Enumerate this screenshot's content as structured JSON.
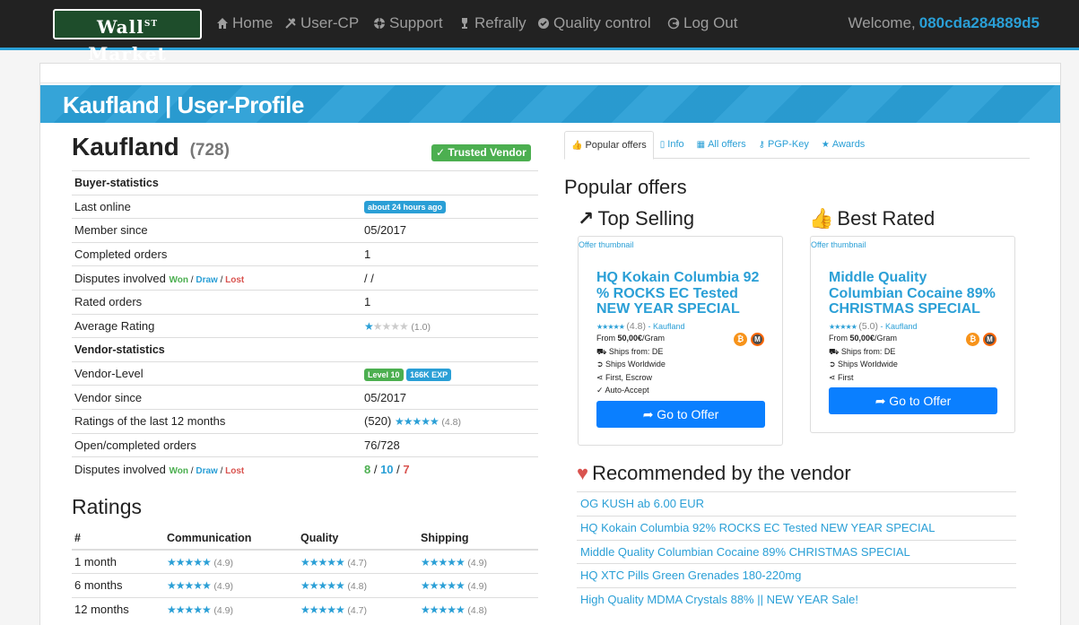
{
  "nav": {
    "logo_main": "Wall",
    "logo_sup": "ST",
    "logo_end": " Market",
    "items": [
      {
        "label": "Home",
        "icon": "home-icon"
      },
      {
        "label": "User-CP",
        "icon": "tools-icon"
      },
      {
        "label": "Support",
        "icon": "lifebuoy-icon"
      },
      {
        "label": "Refrally",
        "icon": "trophy-icon"
      },
      {
        "label": "Quality control",
        "icon": "check-circle-icon"
      },
      {
        "label": "Log Out",
        "icon": "logout-icon"
      }
    ],
    "welcome_label": "Welcome,",
    "username": "080cda284889d5"
  },
  "banner": {
    "title": "Kaufland | User-Profile"
  },
  "vendor": {
    "name": "Kaufland",
    "count": "(728)",
    "trusted_badge": "Trusted Vendor"
  },
  "stats": {
    "buyer_section": "Buyer-statistics",
    "last_online_label": "Last online",
    "last_online_value": "about 24 hours ago",
    "member_since_label": "Member since",
    "member_since_value": "05/2017",
    "completed_orders_label": "Completed orders",
    "completed_orders_value": "1",
    "disputes_label": "Disputes involved",
    "won": "Won",
    "draw": "Draw",
    "lost": "Lost",
    "buyer_disputes_value": "/ /",
    "rated_orders_label": "Rated orders",
    "rated_orders_value": "1",
    "avg_rating_label": "Average Rating",
    "avg_rating_value": "(1.0)",
    "avg_rating_stars": 1,
    "vendor_section": "Vendor-statistics",
    "vendor_level_label": "Vendor-Level",
    "vendor_level_badge": "Level 10",
    "vendor_exp_badge": "166K EXP",
    "vendor_since_label": "Vendor since",
    "vendor_since_value": "05/2017",
    "ratings12_label": "Ratings of the last 12 months",
    "ratings12_count": "(520)",
    "ratings12_score": "(4.8)",
    "open_completed_label": "Open/completed orders",
    "open_completed_value": "76/728",
    "vendor_disputes_won": "8",
    "vendor_disputes_draw": "10",
    "vendor_disputes_lost": "7"
  },
  "ratings": {
    "title": "Ratings",
    "headers": [
      "#",
      "Communication",
      "Quality",
      "Shipping"
    ],
    "rows": [
      {
        "period": "1 month",
        "communication": "(4.9)",
        "quality": "(4.7)",
        "shipping": "(4.9)"
      },
      {
        "period": "6 months",
        "communication": "(4.9)",
        "quality": "(4.8)",
        "shipping": "(4.9)"
      },
      {
        "period": "12 months",
        "communication": "(4.9)",
        "quality": "(4.7)",
        "shipping": "(4.8)"
      }
    ]
  },
  "tabs": [
    {
      "label": "Popular offers",
      "icon": "thumbs-up-icon",
      "glyph": "👍",
      "active": true
    },
    {
      "label": "Info",
      "icon": "info-icon",
      "glyph": "▯"
    },
    {
      "label": "All offers",
      "icon": "list-icon",
      "glyph": "▦"
    },
    {
      "label": "PGP-Key",
      "icon": "key-icon",
      "glyph": "⚷"
    },
    {
      "label": "Awards",
      "icon": "star-icon",
      "glyph": "★"
    }
  ],
  "popular": {
    "title": "Popular offers",
    "top_selling": "Top Selling",
    "best_rated": "Best Rated",
    "thumb_alt": "Offer thumbnail",
    "go_label": "➦ Go to Offer",
    "offers": [
      {
        "title": "HQ Kokain Columbia 92 % ROCKS EC Tested NEW YEAR SPECIAL",
        "rating": "(4.8)",
        "vendor": "- Kaufland",
        "price_prefix": "From ",
        "price": "50,00€",
        "price_unit": "/Gram",
        "ships_from": "Ships from: DE",
        "ships_to": "Ships Worldwide",
        "payment": "First, Escrow",
        "accept": "Auto-Accept"
      },
      {
        "title": "Middle Quality Columbian Cocaine 89% CHRISTMAS SPECIAL",
        "rating": "(5.0)",
        "vendor": "- Kaufland",
        "price_prefix": "From ",
        "price": "50,00€",
        "price_unit": "/Gram",
        "ships_from": "Ships from: DE",
        "ships_to": "Ships Worldwide",
        "payment": "First"
      }
    ]
  },
  "recommended": {
    "title": "Recommended by the vendor",
    "items": [
      "OG KUSH ab 6.00 EUR",
      "HQ Kokain Columbia 92% ROCKS EC Tested NEW YEAR SPECIAL",
      "Middle Quality Columbian Cocaine 89% CHRISTMAS SPECIAL",
      "HQ XTC Pills Green Grenades 180-220mg",
      "High Quality MDMA Crystals 88% || NEW YEAR Sale!"
    ]
  },
  "colors": {
    "accent": "#2a9fd6",
    "success": "#4caf50",
    "danger": "#d9534f",
    "button": "#0a7fff",
    "navbar": "#222222"
  }
}
